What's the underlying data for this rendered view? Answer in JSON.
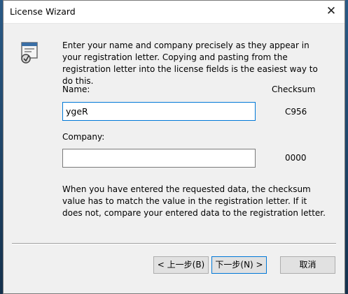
{
  "window": {
    "title": "License Wizard",
    "close_glyph": "✕"
  },
  "intro_text": "Enter your name and company precisely as they appear in your registration letter.  Copying and pasting from the registration letter into the license fields is the easiest way to do this.",
  "fields": {
    "name_label": "Name:",
    "name_value": "ygeR",
    "company_label": "Company:",
    "company_value": ""
  },
  "checksum": {
    "header": "Checksum",
    "name_value": "C956",
    "company_value": "0000"
  },
  "note_text": "When you have entered the requested data, the checksum value has to match the value in the registration letter.  If it does not, compare your entered data to the registration letter.",
  "buttons": {
    "back": "< 上一步(B)",
    "next": "下一步(N) >",
    "cancel": "取消"
  },
  "icons": {
    "wizard": "wizard-icon",
    "close": "close-icon"
  }
}
